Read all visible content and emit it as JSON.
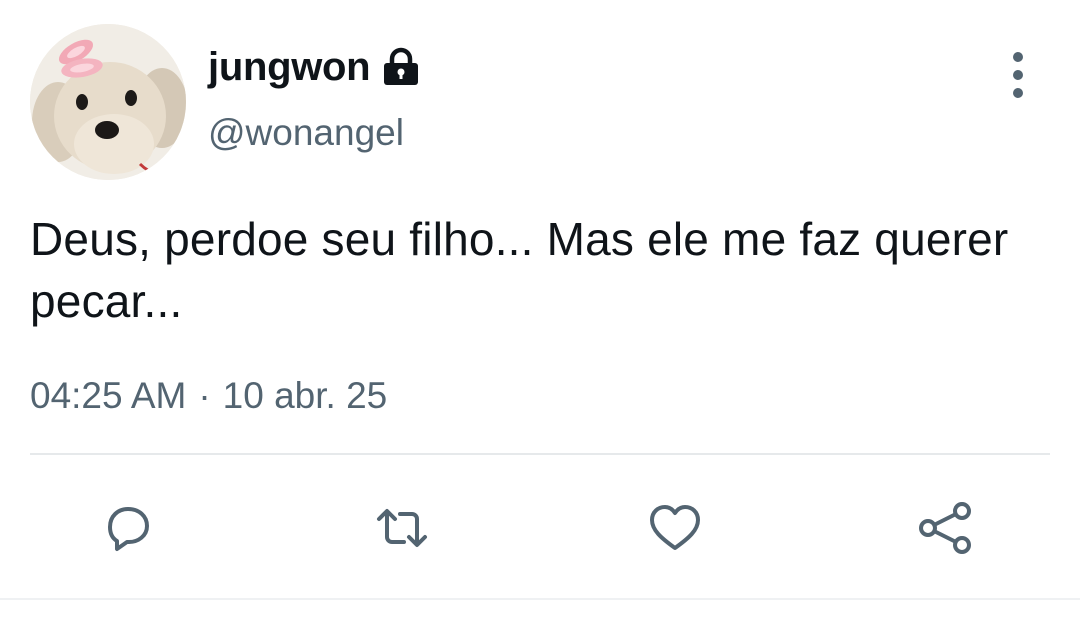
{
  "user": {
    "display_name": "jungwon",
    "handle": "@wonangel",
    "protected_icon": "lock-icon",
    "avatar": "avatar-photo"
  },
  "tweet": {
    "text": "Deus, perdoe seu filho... Mas ele me faz querer pecar...",
    "time": "04:25 AM",
    "separator": "·",
    "date": "10 abr. 25"
  },
  "actions": [
    {
      "icon": "reply-icon"
    },
    {
      "icon": "retweet-icon"
    },
    {
      "icon": "like-icon"
    },
    {
      "icon": "share-icon"
    }
  ],
  "menu": {
    "icon": "more-options-icon"
  },
  "colors": {
    "text_primary": "#0f1419",
    "text_secondary": "#536471",
    "divider": "#e6e9eb"
  }
}
